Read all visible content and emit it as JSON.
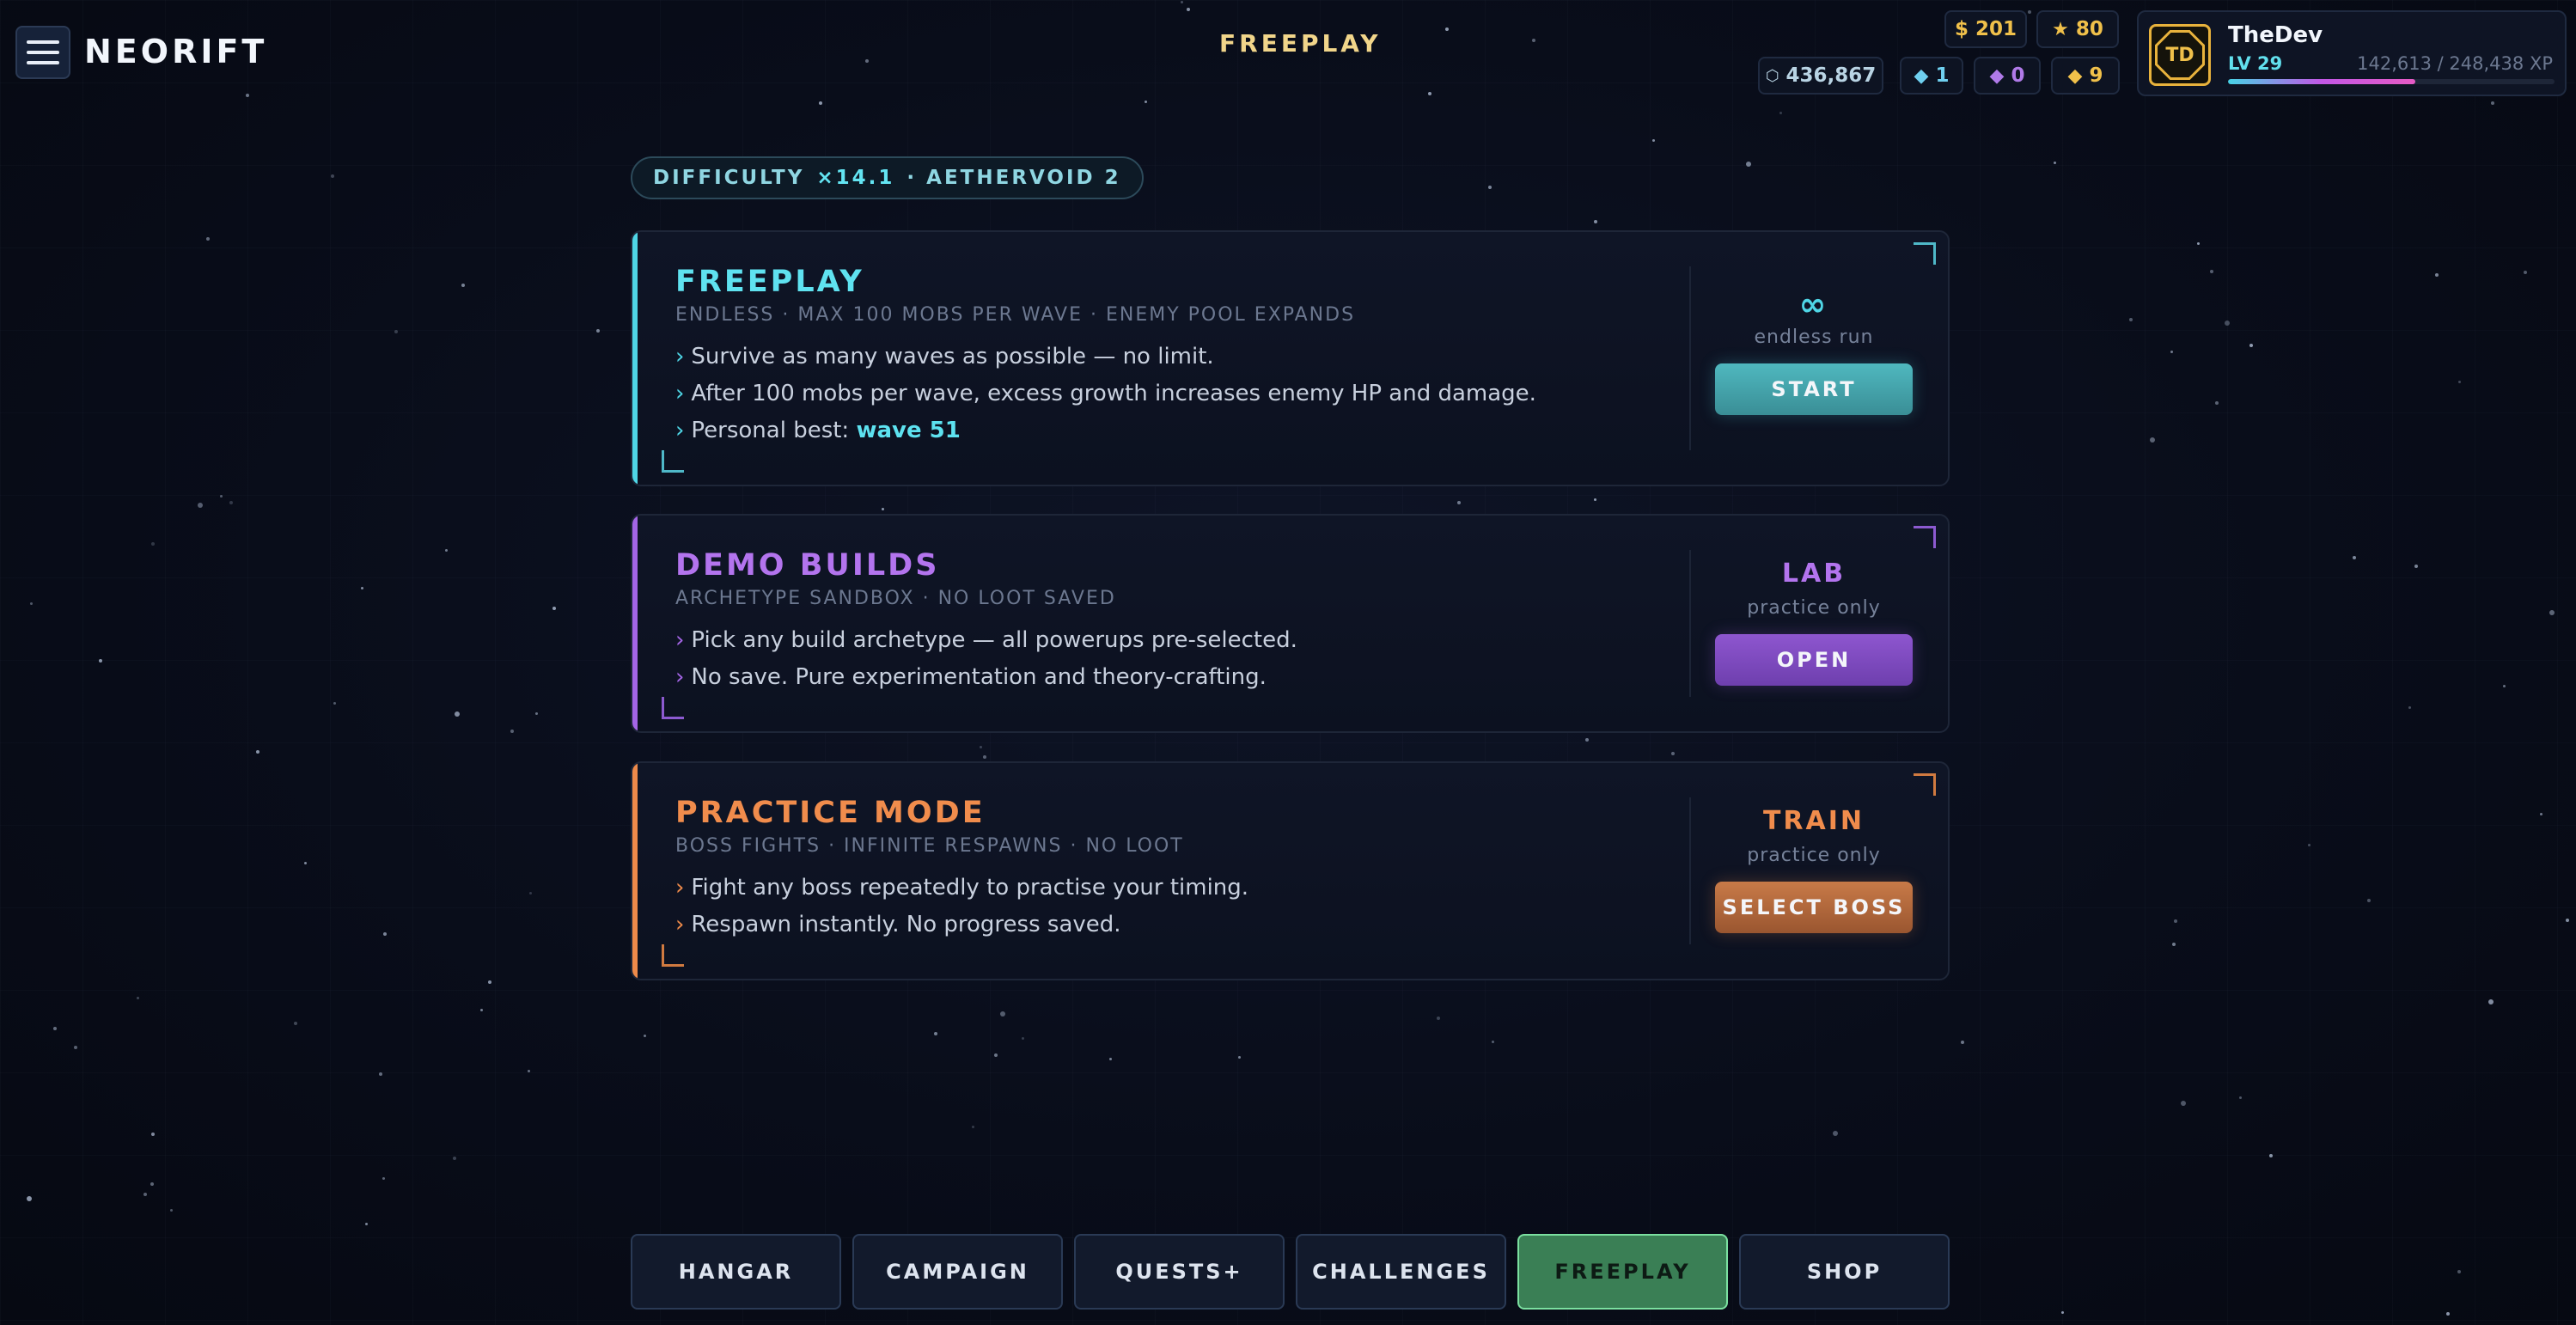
{
  "header": {
    "logo": "NEORIFT",
    "screen_title": "FREEPLAY"
  },
  "currencies": {
    "cash": "$ 201",
    "stars": "80",
    "credits": "436,867",
    "blue_gems": "1",
    "purple_gems": "0",
    "gold_gems": "9"
  },
  "profile": {
    "initials": "TD",
    "name": "TheDev",
    "level": "LV 29",
    "xp": "142,613 / 248,438 XP",
    "xp_progress": 0.574
  },
  "difficulty": {
    "label": "DIFFICULTY",
    "multiplier": "×14.1",
    "zone": "· AETHERVOID 2"
  },
  "modes": [
    {
      "title": "FREEPLAY",
      "subtitle": "ENDLESS · MAX 100 MOBS PER WAVE · ENEMY POOL EXPANDS",
      "lines": [
        "Survive as many waves as possible — no limit.",
        "After 100 mobs per wave, excess growth increases enemy HP and damage."
      ],
      "best_prefix": "Personal best: ",
      "best_value": "wave 51",
      "side_big": "∞",
      "side_small": "endless run",
      "button": "START",
      "color": "#4fd6e6"
    },
    {
      "title": "DEMO BUILDS",
      "subtitle": "ARCHETYPE SANDBOX · NO LOOT SAVED",
      "lines": [
        "Pick any build archetype — all powerups pre-selected.",
        "No save. Pure experimentation and theory-crafting."
      ],
      "side_big": "LAB",
      "side_small": "practice only",
      "button": "OPEN",
      "color": "#a465e6"
    },
    {
      "title": "PRACTICE MODE",
      "subtitle": "BOSS FIGHTS · INFINITE RESPAWNS · NO LOOT",
      "lines": [
        "Fight any boss repeatedly to practise your timing.",
        "Respawn instantly. No progress saved."
      ],
      "side_big": "TRAIN",
      "side_small": "practice only",
      "button": "SELECT BOSS",
      "color": "#ee8a4a"
    }
  ],
  "nav": {
    "items": [
      "HANGAR",
      "CAMPAIGN",
      "QUESTS+",
      "CHALLENGES",
      "FREEPLAY",
      "SHOP"
    ],
    "active": "FREEPLAY"
  },
  "icons": {
    "menu": "hamburger-icon",
    "star": "star-icon",
    "credits": "hexagon-icon",
    "gem": "diamond-icon"
  }
}
